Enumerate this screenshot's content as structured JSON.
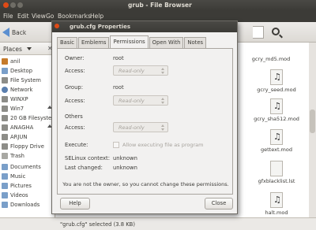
{
  "browser": {
    "title": "grub - File Browser",
    "menu": [
      "File",
      "Edit",
      "View",
      "Go",
      "Bookmarks",
      "Help"
    ],
    "back_label": "Back",
    "status": "\"grub.cfg\" selected (3.8 KB)"
  },
  "sidebar": {
    "header": "Places",
    "items": [
      {
        "label": "anil",
        "icon": "home-icon"
      },
      {
        "label": "Desktop",
        "icon": "folder-icon"
      },
      {
        "label": "File System",
        "icon": "drive-icon"
      },
      {
        "label": "Network",
        "icon": "network-icon"
      },
      {
        "label": "WINXP",
        "icon": "drive-icon"
      },
      {
        "label": "Win7",
        "icon": "drive-icon"
      },
      {
        "label": "20 GB Filesystem",
        "icon": "drive-icon"
      },
      {
        "label": "ANAGHA",
        "icon": "drive-icon"
      },
      {
        "label": "ARJUN",
        "icon": "drive-icon"
      },
      {
        "label": "Floppy Drive",
        "icon": "drive-icon"
      },
      {
        "label": "Trash",
        "icon": "trash-icon"
      },
      {
        "label": "Documents",
        "icon": "folder-icon"
      },
      {
        "label": "Music",
        "icon": "folder-icon"
      },
      {
        "label": "Pictures",
        "icon": "folder-icon"
      },
      {
        "label": "Videos",
        "icon": "folder-icon"
      },
      {
        "label": "Downloads",
        "icon": "folder-icon"
      }
    ]
  },
  "files": [
    {
      "name": "gcry_md5.mod",
      "icon": "music-file-icon"
    },
    {
      "name": "gcry_seed.mod",
      "icon": "music-file-icon"
    },
    {
      "name": "gcry_sha512.mod",
      "icon": "music-file-icon"
    },
    {
      "name": "gettext.mod",
      "icon": "music-file-icon"
    },
    {
      "name": "gfxblacklist.lst",
      "icon": "text-file-icon"
    },
    {
      "name": "halt.mod",
      "icon": "music-file-icon"
    }
  ],
  "dialog": {
    "title": "grub.cfg Properties",
    "tabs": [
      "Basic",
      "Emblems",
      "Permissions",
      "Open With",
      "Notes"
    ],
    "active_tab": "Permissions",
    "owner_label": "Owner:",
    "owner_value": "root",
    "access_label": "Access:",
    "access_value": "Read-only",
    "group_label": "Group:",
    "group_value": "root",
    "others_label": "Others",
    "execute_label": "Execute:",
    "execute_check": "Allow executing file as program",
    "selinux_label": "SELinux context:",
    "selinux_value": "unknown",
    "lastchanged_label": "Last changed:",
    "lastchanged_value": "unknown",
    "notice": "You are not the owner, so you cannot change these permissions.",
    "help_label": "Help",
    "close_label": "Close"
  }
}
